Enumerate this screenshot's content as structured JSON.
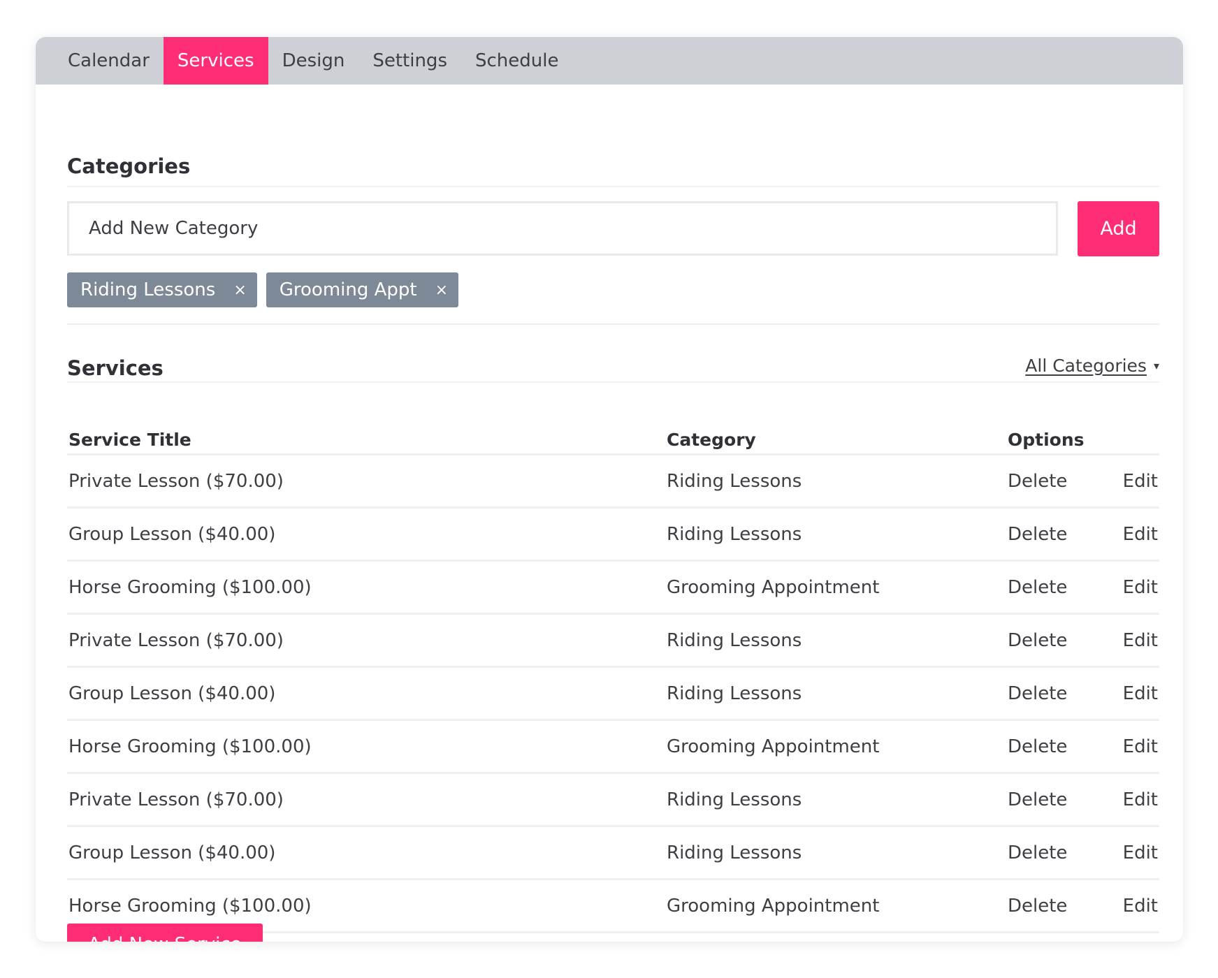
{
  "tabs": [
    {
      "label": "Calendar",
      "active": false
    },
    {
      "label": "Services",
      "active": true
    },
    {
      "label": "Design",
      "active": false
    },
    {
      "label": "Settings",
      "active": false
    },
    {
      "label": "Schedule",
      "active": false
    }
  ],
  "categories": {
    "title": "Categories",
    "input_placeholder": "Add New Category",
    "add_label": "Add",
    "chips": [
      {
        "label": "Riding Lessons",
        "remove": "×"
      },
      {
        "label": "Grooming Appt",
        "remove": "×"
      }
    ]
  },
  "services": {
    "title": "Services",
    "filter_label": "All Categories",
    "filter_caret": "▾",
    "columns": {
      "title": "Service Title",
      "category": "Category",
      "options": "Options"
    },
    "rows": [
      {
        "title": "Private Lesson ($70.00)",
        "category": "Riding Lessons",
        "delete": "Delete",
        "edit": "Edit"
      },
      {
        "title": "Group Lesson ($40.00)",
        "category": "Riding Lessons",
        "delete": "Delete",
        "edit": "Edit"
      },
      {
        "title": "Horse Grooming ($100.00)",
        "category": "Grooming Appointment",
        "delete": "Delete",
        "edit": "Edit"
      },
      {
        "title": "Private Lesson ($70.00)",
        "category": "Riding Lessons",
        "delete": "Delete",
        "edit": "Edit"
      },
      {
        "title": "Group Lesson ($40.00)",
        "category": "Riding Lessons",
        "delete": "Delete",
        "edit": "Edit"
      },
      {
        "title": "Horse Grooming ($100.00)",
        "category": "Grooming Appointment",
        "delete": "Delete",
        "edit": "Edit"
      },
      {
        "title": "Private Lesson ($70.00)",
        "category": "Riding Lessons",
        "delete": "Delete",
        "edit": "Edit"
      },
      {
        "title": "Group Lesson ($40.00)",
        "category": "Riding Lessons",
        "delete": "Delete",
        "edit": "Edit"
      },
      {
        "title": "Horse Grooming ($100.00)",
        "category": "Grooming Appointment",
        "delete": "Delete",
        "edit": "Edit"
      }
    ],
    "add_service_label": "Add New Service"
  },
  "colors": {
    "accent": "#fe2d76",
    "tabbar": "#cdd1d6",
    "chip": "#7d8996"
  }
}
